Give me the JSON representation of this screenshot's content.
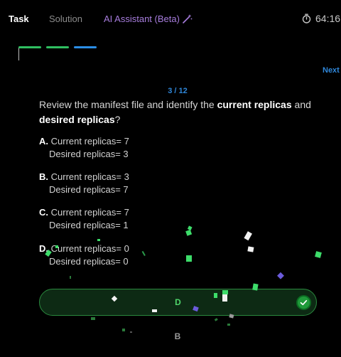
{
  "tabs": {
    "task": "Task",
    "solution": "Solution",
    "ai_assistant": "AI Assistant (Beta)"
  },
  "timer": "64:16",
  "progress": {
    "segments": [
      "complete",
      "complete",
      "current"
    ]
  },
  "nav": {
    "next": "Next"
  },
  "counter": "3 / 12",
  "question": {
    "part1": "Review the manifest file and identify the ",
    "bold1": "current replicas",
    "part2": " and ",
    "bold2": "desired replicas",
    "part3": "?"
  },
  "options": [
    {
      "letter": "A.",
      "line1": "Current replicas= 7",
      "line2": "Desired replicas= 3"
    },
    {
      "letter": "B.",
      "line1": "Current replicas= 3",
      "line2": "Desired replicas= 7"
    },
    {
      "letter": "C.",
      "line1": "Current replicas= 7",
      "line2": "Desired replicas= 1"
    },
    {
      "letter": "D.",
      "line1": "Current replicas= 0",
      "line2": "Desired replicas= 0"
    }
  ],
  "selected_answer": "D",
  "next_answer": "B",
  "colors": {
    "accent_green": "#2fbf60",
    "accent_blue": "#2f86d8",
    "ai_purple": "#a77ddd"
  }
}
